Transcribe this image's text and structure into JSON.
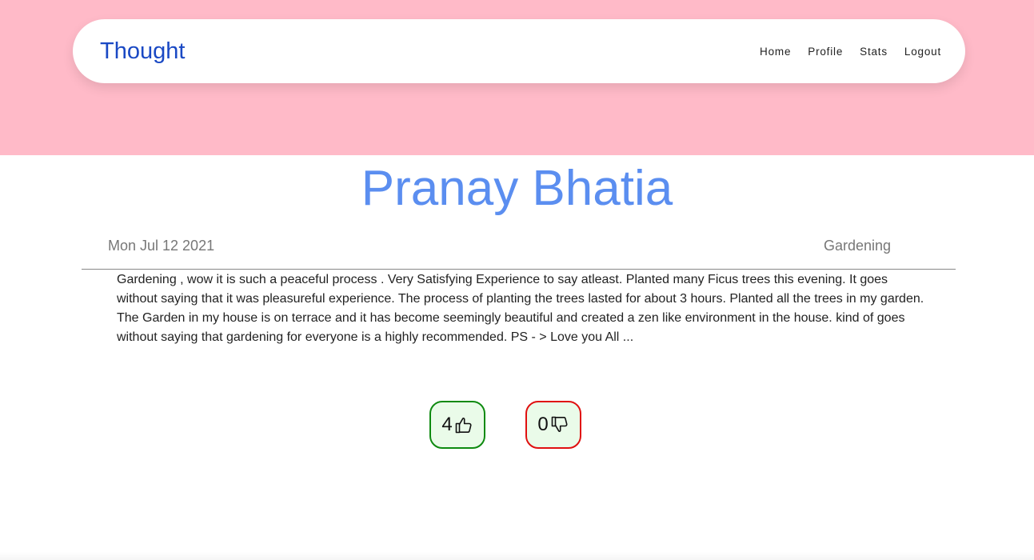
{
  "navbar": {
    "brand": "Thought",
    "links": [
      {
        "label": "Home"
      },
      {
        "label": "Profile"
      },
      {
        "label": "Stats"
      },
      {
        "label": "Logout"
      }
    ]
  },
  "post": {
    "author": "Pranay Bhatia",
    "date": "Mon Jul 12 2021",
    "category": "Gardening",
    "content": "Gardening , wow it is such a peaceful process . Very Satisfying Experience to say atleast. Planted many Ficus trees this evening. It goes without saying that it was pleasureful experience. The process of planting the trees lasted for about 3 hours. Planted all the trees in my garden. The Garden in my house is on terrace and it has become seemingly beautiful and created a zen like environment in the house. kind of goes without saying that gardening for everyone is a highly recommended. PS - > Love you All ..."
  },
  "votes": {
    "likes": "4",
    "dislikes": "0",
    "like_icon": "thumbs-up-icon",
    "dislike_icon": "thumbs-down-icon"
  },
  "colors": {
    "hero_background": "#ffbac8",
    "brand": "#1a49c4",
    "author": "#5b8ef0",
    "like_border": "#0e8a10",
    "dislike_border": "#e01010",
    "vote_background": "#eafbe9"
  }
}
